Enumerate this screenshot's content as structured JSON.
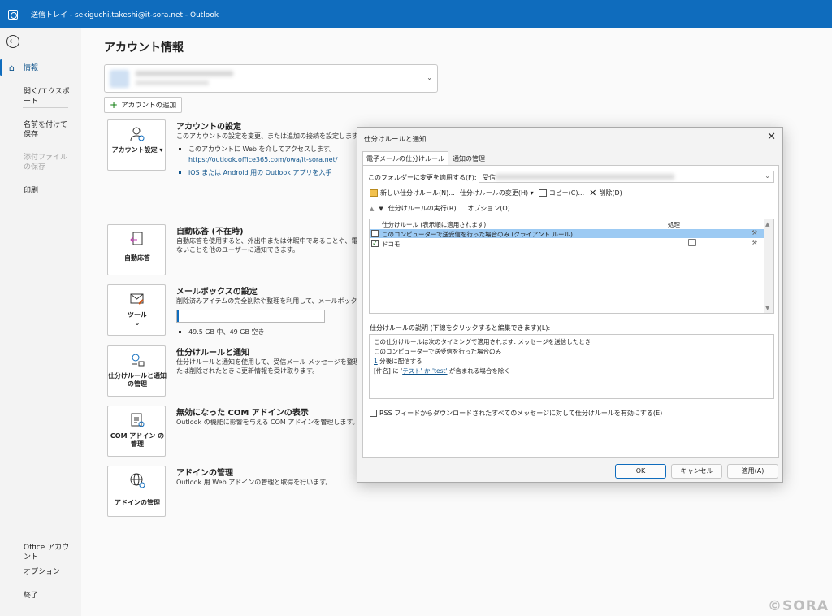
{
  "window": {
    "title": "送信トレイ - sekiguchi.takeshi@it-sora.net  -  Outlook"
  },
  "nav": {
    "info": "情報",
    "open_export": "開く/エクスポート",
    "save_as": "名前を付けて保存",
    "save_attachments": "添付ファイルの保存",
    "print": "印刷",
    "office_account": "Office アカウント",
    "options": "オプション",
    "exit": "終了"
  },
  "main": {
    "title": "アカウント情報",
    "add_account": "アカウントの追加",
    "sections": {
      "account_settings": {
        "tile": "アカウント設定 ▾",
        "title": "アカウントの設定",
        "desc": "このアカウントの設定を変更、または追加の接続を設定します。",
        "bullet1": "このアカウントに Web を介してアクセスします。",
        "link1": "https://outlook.office365.com/owa/it-sora.net/",
        "link2": "iOS または Android 用の Outlook アプリを入手"
      },
      "auto_reply": {
        "tile": "自動応答",
        "title": "自動応答 (不在時)",
        "desc1": "自動応答を使用すると、外出中または休暇中であることや、電子",
        "desc2": "ないことを他のユーザーに通知できます。"
      },
      "mailbox": {
        "tile": "ツール",
        "title": "メールボックスの設定",
        "desc": "削除済みアイテムの完全削除や整理を利用して、メールボックスのサ",
        "storage": "49.5 GB 中、49 GB 空き",
        "used_fraction": 0.01
      },
      "rules": {
        "tile": "仕分けルールと通知の管理",
        "title": "仕分けルールと通知",
        "desc1": "仕分けルールと通知を使用して、受信メール メッセージを整理し、",
        "desc2": "たは削除されたときに更新情報を受け取ります。"
      },
      "com_addins": {
        "tile": "COM アドイン の管理",
        "title": "無効になった COM アドインの表示",
        "desc": "Outlook の機能に影響を与える COM アドインを管理します。"
      },
      "addins": {
        "tile": "アドインの管理",
        "title": "アドインの管理",
        "desc": "Outlook 用 Web アドインの管理と取得を行います。"
      }
    }
  },
  "dialog": {
    "title": "仕分けルールと通知",
    "tabs": [
      "電子メールの仕分けルール",
      "通知の管理"
    ],
    "folder_label": "このフォルダーに変更を適用する(F):",
    "folder_value_prefix": "受信",
    "toolbar": {
      "new_rule": "新しい仕分けルール(N)...",
      "change_rule": "仕分けルールの変更(H) ▾",
      "copy": "コピー(C)...",
      "delete": "削除(D)"
    },
    "toolbar2": {
      "run_rules": "仕分けルールの実行(R)...",
      "options": "オプション(O)"
    },
    "table": {
      "col_rule": "仕分けルール (表示順に適用されます)",
      "col_action": "処理",
      "rows": [
        {
          "name": "このコンピューターで送受信を行った場合のみ (クライアント ルール)",
          "checked": false,
          "selected": true
        },
        {
          "name": "ドコモ",
          "checked": true,
          "selected": false
        }
      ]
    },
    "desc_label": "仕分けルールの説明 (下線をクリックすると編集できます)(L):",
    "desc_lines": {
      "l1": "この仕分けルールは次のタイミングで適用されます: メッセージを送信したとき",
      "l2": "このコンピューターで送受信を行った場合のみ",
      "l3_link": "1",
      "l3_text": " 分後に配信する",
      "l4_pre": "[件名] に '",
      "l4_link": "テスト' か 'test'",
      "l4_post": " が含まれる場合を除く"
    },
    "rss_label": "RSS フィードからダウンロードされたすべてのメッセージに対して仕分けルールを有効にする(E)",
    "ok": "OK",
    "cancel": "キャンセル",
    "apply": "適用(A)"
  },
  "watermark": "©SORA",
  "colors": {
    "accent": "#0f6cbd",
    "selection": "#9ccaf3"
  }
}
